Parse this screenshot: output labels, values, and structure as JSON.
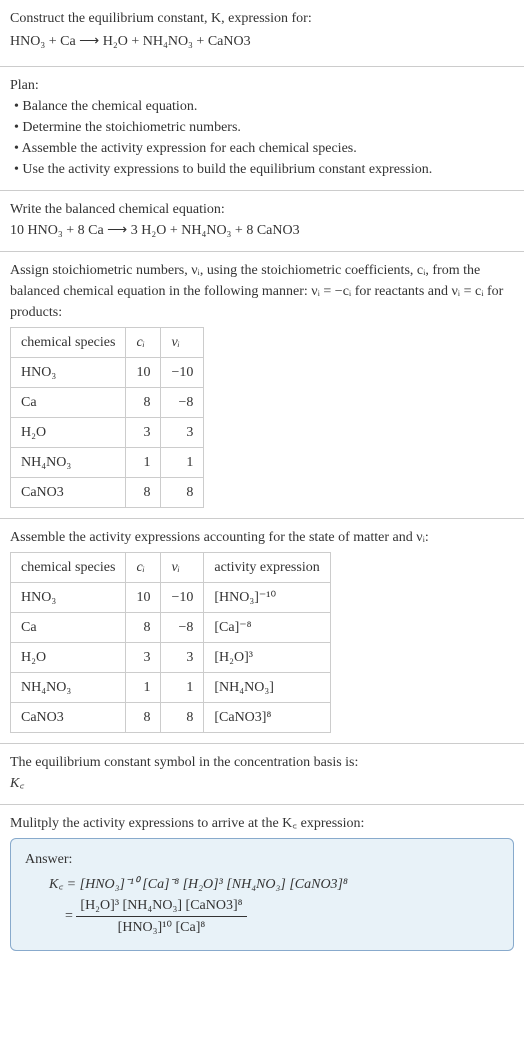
{
  "intro": {
    "line1": "Construct the equilibrium constant, K, expression for:",
    "eq": "HNO₃ + Ca ⟶ H₂O + NH₄NO₃ + CaNO3"
  },
  "plan": {
    "title": "Plan:",
    "b1": "• Balance the chemical equation.",
    "b2": "• Determine the stoichiometric numbers.",
    "b3": "• Assemble the activity expression for each chemical species.",
    "b4": "• Use the activity expressions to build the equilibrium constant expression."
  },
  "balanced": {
    "title": "Write the balanced chemical equation:",
    "eq": "10 HNO₃ + 8 Ca ⟶ 3 H₂O + NH₄NO₃ + 8 CaNO3"
  },
  "assign": {
    "p1": "Assign stoichiometric numbers, νᵢ, using the stoichiometric coefficients, cᵢ, from the balanced chemical equation in the following manner: νᵢ = −cᵢ for reactants and νᵢ = cᵢ for products:"
  },
  "table1": {
    "h1": "chemical species",
    "h2": "cᵢ",
    "h3": "νᵢ",
    "rows": [
      {
        "sp": "HNO₃",
        "c": "10",
        "v": "−10"
      },
      {
        "sp": "Ca",
        "c": "8",
        "v": "−8"
      },
      {
        "sp": "H₂O",
        "c": "3",
        "v": "3"
      },
      {
        "sp": "NH₄NO₃",
        "c": "1",
        "v": "1"
      },
      {
        "sp": "CaNO3",
        "c": "8",
        "v": "8"
      }
    ]
  },
  "assemble": {
    "p1": "Assemble the activity expressions accounting for the state of matter and νᵢ:"
  },
  "table2": {
    "h1": "chemical species",
    "h2": "cᵢ",
    "h3": "νᵢ",
    "h4": "activity expression",
    "rows": [
      {
        "sp": "HNO₃",
        "c": "10",
        "v": "−10",
        "a": "[HNO₃]⁻¹⁰"
      },
      {
        "sp": "Ca",
        "c": "8",
        "v": "−8",
        "a": "[Ca]⁻⁸"
      },
      {
        "sp": "H₂O",
        "c": "3",
        "v": "3",
        "a": "[H₂O]³"
      },
      {
        "sp": "NH₄NO₃",
        "c": "1",
        "v": "1",
        "a": "[NH₄NO₃]"
      },
      {
        "sp": "CaNO3",
        "c": "8",
        "v": "8",
        "a": "[CaNO3]⁸"
      }
    ]
  },
  "symbol": {
    "p1": "The equilibrium constant symbol in the concentration basis is:",
    "p2": "K꜀"
  },
  "mult": {
    "p1": "Mulitply the activity expressions to arrive at the K꜀ expression:"
  },
  "answer": {
    "label": "Answer:",
    "line1a": "K꜀ = [HNO₃]⁻¹⁰ [Ca]⁻⁸ [H₂O]³ [NH₄NO₃] [CaNO3]⁸",
    "eqsign": "= ",
    "num": "[H₂O]³ [NH₄NO₃] [CaNO3]⁸",
    "den": "[HNO₃]¹⁰ [Ca]⁸"
  }
}
